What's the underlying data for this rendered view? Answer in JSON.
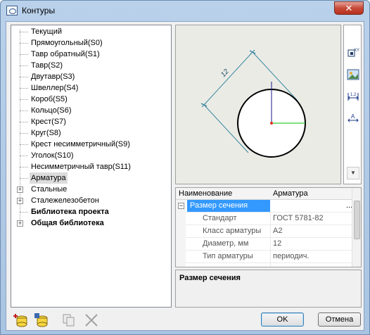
{
  "window": {
    "title": "Контуры",
    "close_glyph": "✕"
  },
  "tree": {
    "items": [
      {
        "label": "Текущий",
        "bold": false,
        "expander": "",
        "selected": false
      },
      {
        "label": "Прямоугольный(S0)",
        "bold": false,
        "expander": "",
        "selected": false
      },
      {
        "label": "Тавр обратный(S1)",
        "bold": false,
        "expander": "",
        "selected": false
      },
      {
        "label": "Тавр(S2)",
        "bold": false,
        "expander": "",
        "selected": false
      },
      {
        "label": "Двутавр(S3)",
        "bold": false,
        "expander": "",
        "selected": false
      },
      {
        "label": "Швеллер(S4)",
        "bold": false,
        "expander": "",
        "selected": false
      },
      {
        "label": "Короб(S5)",
        "bold": false,
        "expander": "",
        "selected": false
      },
      {
        "label": "Кольцо(S6)",
        "bold": false,
        "expander": "",
        "selected": false
      },
      {
        "label": "Крест(S7)",
        "bold": false,
        "expander": "",
        "selected": false
      },
      {
        "label": "Круг(S8)",
        "bold": false,
        "expander": "",
        "selected": false
      },
      {
        "label": "Крест несимметричный(S9)",
        "bold": false,
        "expander": "",
        "selected": false
      },
      {
        "label": "Уголок(S10)",
        "bold": false,
        "expander": "",
        "selected": false
      },
      {
        "label": "Несимметричный тавр(S11)",
        "bold": false,
        "expander": "",
        "selected": false
      },
      {
        "label": "Арматура",
        "bold": false,
        "expander": "",
        "selected": true
      },
      {
        "label": "Стальные",
        "bold": false,
        "expander": "+",
        "selected": false
      },
      {
        "label": "Сталежелезобетон",
        "bold": false,
        "expander": "+",
        "selected": false
      },
      {
        "label": "Библиотека проекта",
        "bold": true,
        "expander": "",
        "selected": false
      },
      {
        "label": "Общая библиотека",
        "bold": true,
        "expander": "+",
        "selected": false
      }
    ]
  },
  "preview": {
    "dimension_label": "12",
    "colors": {
      "background": "#ebebe6",
      "dim_line": "#3a8aa0",
      "axis_y": "#1a1a8a",
      "axis_x": "#00c000",
      "origin": "#e03020"
    }
  },
  "side_buttons": [
    {
      "name": "xy-axes-button-icon",
      "glyph": "XY"
    },
    {
      "name": "picture-button-icon",
      "glyph": ""
    },
    {
      "name": "dimension-button-icon",
      "glyph": "1.2"
    },
    {
      "name": "text-button-icon",
      "glyph": "A"
    }
  ],
  "properties": {
    "columns": [
      "Наименование",
      "Арматура"
    ],
    "section_row": {
      "expander": "−",
      "label": "Размер сечения",
      "ellipsis": "..."
    },
    "rows": [
      {
        "name": "Стандарт",
        "value": "ГОСТ 5781-82"
      },
      {
        "name": "Класс арматуры",
        "value": "A2"
      },
      {
        "name": "Диаметр, мм",
        "value": "12"
      },
      {
        "name": "Тип арматуры",
        "value": "периодич."
      },
      {
        "name": "",
        "value": ""
      }
    ]
  },
  "description": {
    "title": "Размер сечения"
  },
  "bottom_icons": [
    {
      "name": "add-database-icon"
    },
    {
      "name": "database-edit-icon"
    },
    {
      "name": "copy-icon"
    },
    {
      "name": "delete-icon"
    }
  ],
  "buttons": {
    "ok": "OK",
    "cancel": "Отмена"
  }
}
